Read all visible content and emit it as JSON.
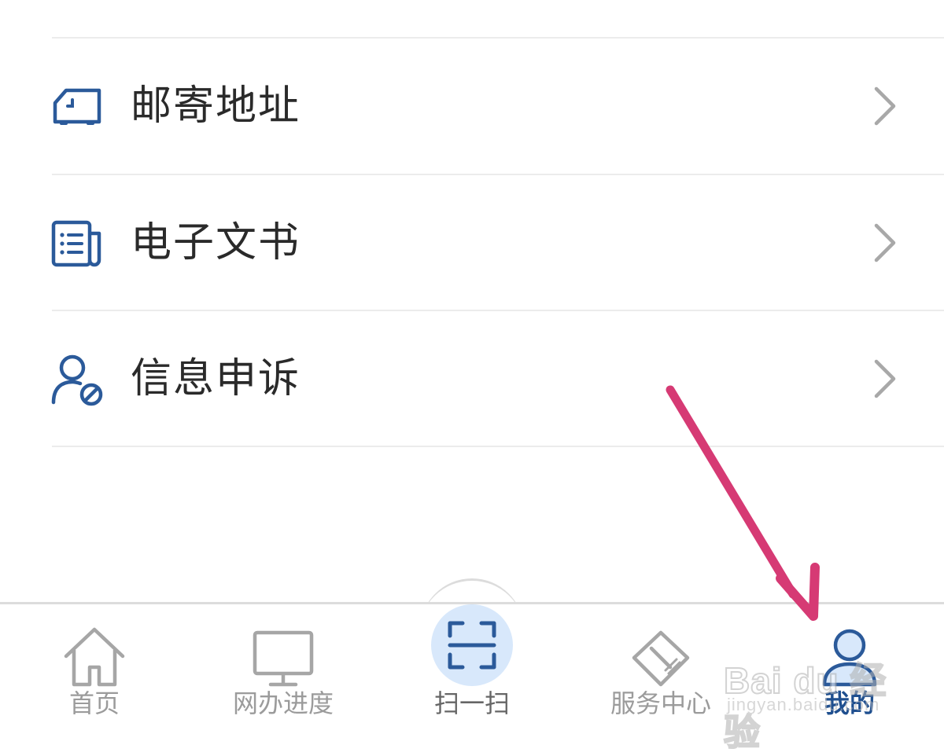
{
  "menu": {
    "items": [
      {
        "label": "邮寄地址",
        "icon": "delivery-truck-icon"
      },
      {
        "label": "电子文书",
        "icon": "document-icon"
      },
      {
        "label": "信息申诉",
        "icon": "user-block-icon"
      }
    ],
    "chevron_icon": "chevron-right-icon"
  },
  "tabbar": {
    "tabs": [
      {
        "label": "首页",
        "icon": "home-icon",
        "active": false
      },
      {
        "label": "网办进度",
        "icon": "monitor-icon",
        "active": false
      },
      {
        "label": "扫一扫",
        "icon": "scan-icon",
        "active": false
      },
      {
        "label": "服务中心",
        "icon": "service-center-icon",
        "active": false
      },
      {
        "label": "我的",
        "icon": "user-icon",
        "active": true
      }
    ]
  },
  "watermark": {
    "brand": "Bai du 经验",
    "sub": "jingyan.baidu.com"
  },
  "colors": {
    "icon_blue": "#2b5a9a",
    "inactive_gray": "#a6a6a6",
    "active_blue": "#1f4f8f",
    "scan_bg": "#d8e8fb",
    "arrow_pink": "#d63a74"
  }
}
